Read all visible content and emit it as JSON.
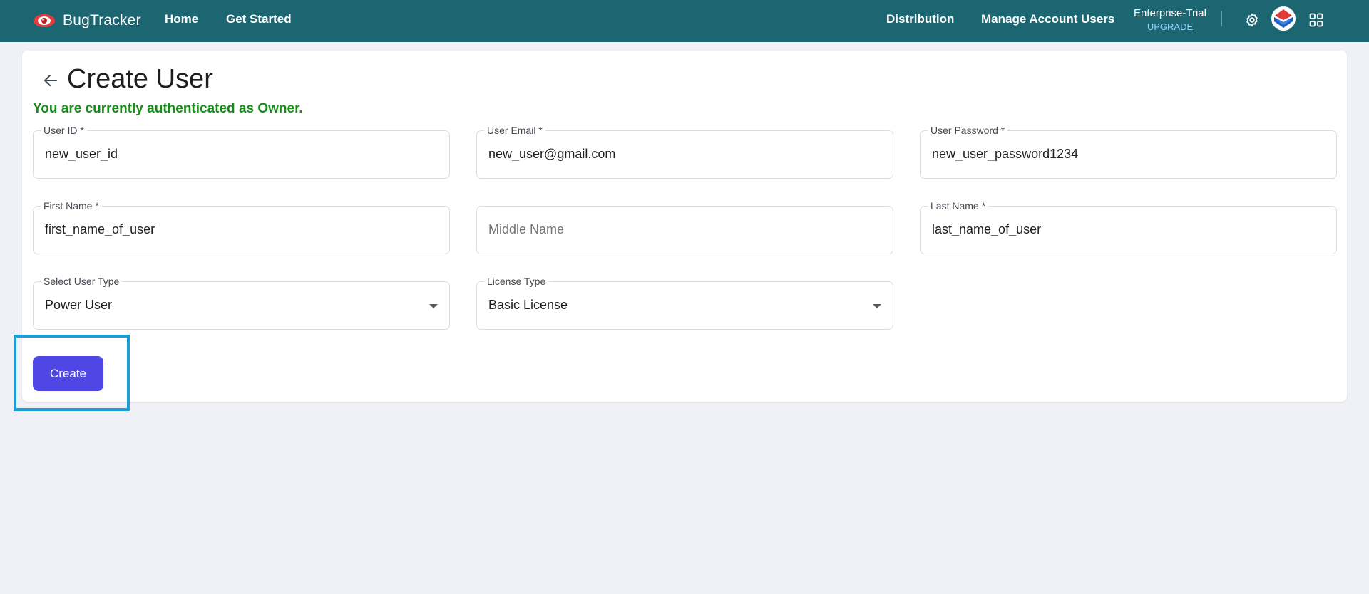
{
  "header": {
    "brand": "BugTracker",
    "brand_icon": "eye-logo-icon",
    "nav_left": [
      {
        "label": "Home"
      },
      {
        "label": "Get Started"
      }
    ],
    "nav_right": [
      {
        "label": "Distribution"
      },
      {
        "label": "Manage Account Users"
      }
    ],
    "plan_name": "Enterprise-Trial",
    "upgrade_label": "UPGRADE",
    "icons": [
      "gear-icon",
      "avatar",
      "apps-grid-icon"
    ]
  },
  "page": {
    "title": "Create User",
    "back_icon": "arrow-left-icon",
    "auth_message": "You are currently authenticated as Owner."
  },
  "form": {
    "user_id": {
      "label": "User ID *",
      "value": "new_user_id"
    },
    "user_email": {
      "label": "User Email *",
      "value": "new_user@gmail.com"
    },
    "user_password": {
      "label": "User Password *",
      "value": "new_user_password1234"
    },
    "first_name": {
      "label": "First Name *",
      "value": "first_name_of_user"
    },
    "middle_name": {
      "label": "",
      "value": "",
      "placeholder": "Middle Name"
    },
    "last_name": {
      "label": "Last Name *",
      "value": "last_name_of_user"
    },
    "user_type": {
      "label": "Select User Type",
      "value": "Power User"
    },
    "license_type": {
      "label": "License Type",
      "value": "Basic License"
    },
    "create_label": "Create"
  },
  "colors": {
    "header_bg": "#1c6672",
    "button_bg": "#4f46e5",
    "auth_text": "#1a8a1a",
    "highlight": "#1aa0d8",
    "upgrade_link": "#8fd3ff"
  }
}
